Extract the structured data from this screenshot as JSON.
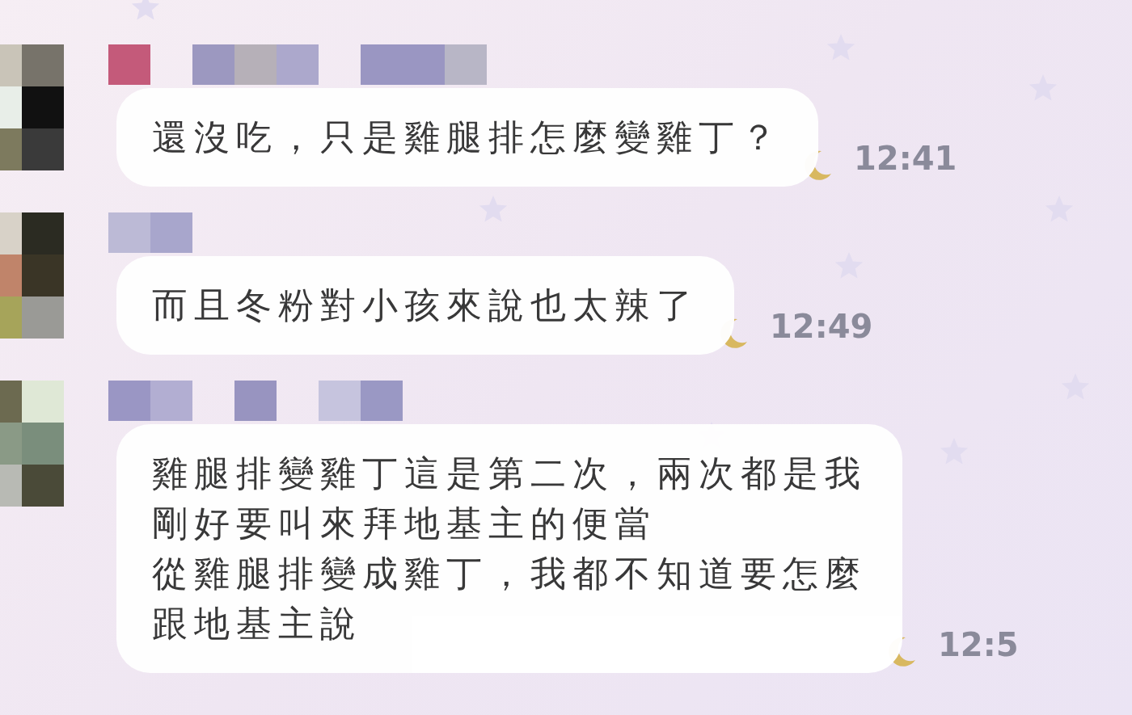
{
  "messages": [
    {
      "lines": [
        "還沒吃，只是雞腿排怎麼變雞丁？"
      ],
      "time": "12:41"
    },
    {
      "lines": [
        "而且冬粉對小孩來說也太辣了"
      ],
      "time": "12:49"
    },
    {
      "lines": [
        "雞腿排變雞丁這是第二次，兩次都是我",
        "剛好要叫來拜地基主的便當",
        "從雞腿排變成雞丁，我都不知道要怎麼",
        "跟地基主說"
      ],
      "time": "12:5"
    }
  ]
}
